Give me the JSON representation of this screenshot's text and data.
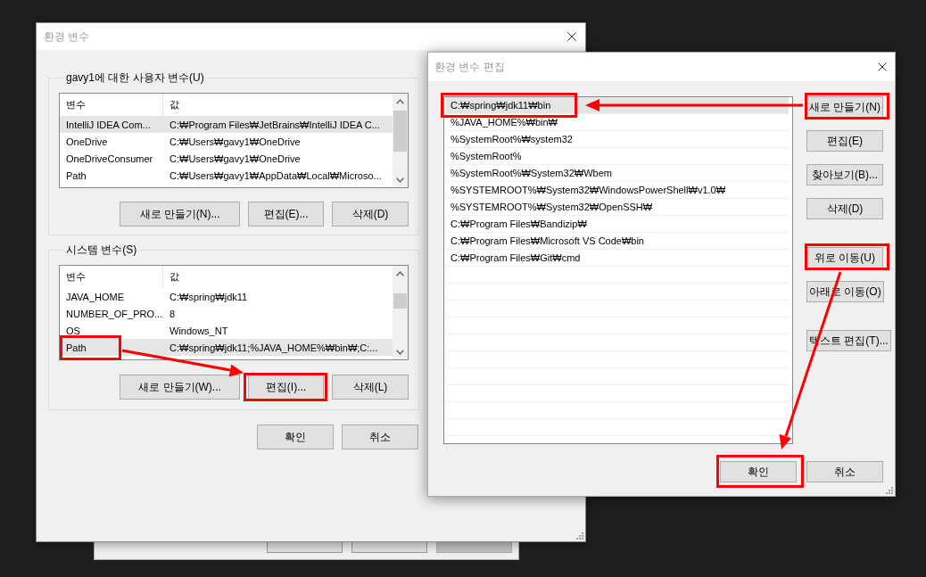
{
  "background_window": {
    "buttons": [
      {
        "disabled": false
      },
      {
        "disabled": false
      },
      {
        "disabled": true
      }
    ]
  },
  "environment_variables": {
    "title": "환경 변수",
    "user_variables": {
      "label": "gavy1에 대한 사용자 변수(U)",
      "columns": [
        "변수",
        "값"
      ],
      "rows": [
        {
          "variable": "IntelliJ IDEA Com...",
          "value": "C:₩Program Files₩JetBrains₩IntelliJ IDEA C...",
          "selected": true
        },
        {
          "variable": "OneDrive",
          "value": "C:₩Users₩gavy1₩OneDrive",
          "selected": false
        },
        {
          "variable": "OneDriveConsumer",
          "value": "C:₩Users₩gavy1₩OneDrive",
          "selected": false
        },
        {
          "variable": "Path",
          "value": "C:₩Users₩gavy1₩AppData₩Local₩Microso...",
          "selected": false
        }
      ],
      "buttons": [
        {
          "label": "새로 만들기(N)..."
        },
        {
          "label": "편집(E)..."
        },
        {
          "label": "삭제(D)"
        }
      ]
    },
    "system_variables": {
      "label": "시스템 변수(S)",
      "columns": [
        "변수",
        "값"
      ],
      "rows": [
        {
          "variable": "JAVA_HOME",
          "value": "C:₩spring₩jdk11",
          "selected": false,
          "marked": false
        },
        {
          "variable": "NUMBER_OF_PRO...",
          "value": "8",
          "selected": false,
          "marked": false
        },
        {
          "variable": "OS",
          "value": "Windows_NT",
          "selected": false,
          "marked": false
        },
        {
          "variable": "Path",
          "value": "C:₩spring₩jdk11;%JAVA_HOME%₩bin₩;C:...",
          "selected": true,
          "marked": true
        }
      ],
      "buttons": [
        {
          "label": "새로 만들기(W)...",
          "marked": false
        },
        {
          "label": "편집(I)...",
          "marked": true
        },
        {
          "label": "삭제(L)",
          "marked": false
        }
      ]
    },
    "buttons": [
      {
        "label": "확인"
      },
      {
        "label": "취소"
      }
    ]
  },
  "edit_dialog": {
    "title": "환경 변수 편집",
    "paths": [
      {
        "text": "C:₩spring₩jdk11₩bin",
        "selected": true,
        "marked": true
      },
      {
        "text": "%JAVA_HOME%₩bin₩",
        "selected": false,
        "marked": false
      },
      {
        "text": "%SystemRoot%₩system32",
        "selected": false,
        "marked": false
      },
      {
        "text": "%SystemRoot%",
        "selected": false,
        "marked": false
      },
      {
        "text": "%SystemRoot%₩System32₩Wbem",
        "selected": false,
        "marked": false
      },
      {
        "text": "%SYSTEMROOT%₩System32₩WindowsPowerShell₩v1.0₩",
        "selected": false,
        "marked": false
      },
      {
        "text": "%SYSTEMROOT%₩System32₩OpenSSH₩",
        "selected": false,
        "marked": false
      },
      {
        "text": "C:₩Program Files₩Bandizip₩",
        "selected": false,
        "marked": false
      },
      {
        "text": "C:₩Program Files₩Microsoft VS Code₩bin",
        "selected": false,
        "marked": false
      },
      {
        "text": "C:₩Program Files₩Git₩cmd",
        "selected": false,
        "marked": false
      }
    ],
    "button_groups": [
      {
        "buttons": [
          {
            "label": "새로 만들기(N)",
            "marked": true
          },
          {
            "label": "편집(E)",
            "marked": false
          },
          {
            "label": "찾아보기(B)...",
            "marked": false
          },
          {
            "label": "삭제(D)",
            "marked": false
          }
        ]
      },
      {
        "buttons": [
          {
            "label": "위로 이동(U)",
            "marked": true
          },
          {
            "label": "아래로 이동(O)",
            "marked": false
          }
        ]
      },
      {
        "buttons": [
          {
            "label": "텍스트 편집(T)...",
            "marked": false
          }
        ]
      }
    ],
    "buttons": [
      {
        "label": "확인",
        "marked": true
      },
      {
        "label": "취소",
        "marked": false
      }
    ]
  }
}
